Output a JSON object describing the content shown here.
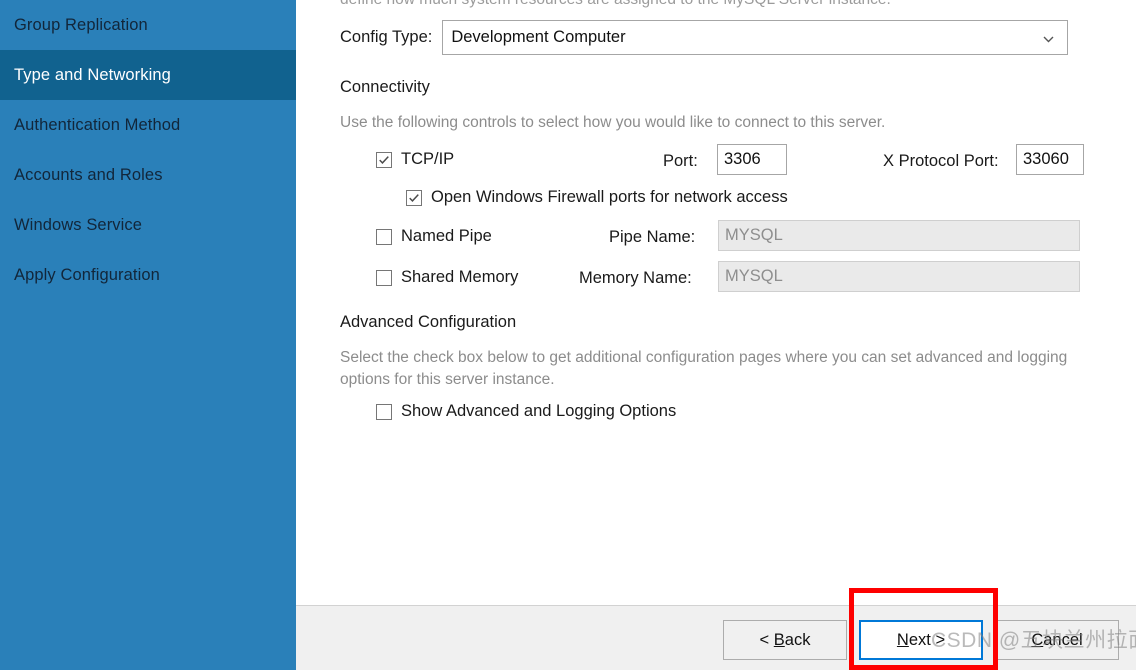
{
  "sidebar": {
    "items": [
      {
        "label": "Group Replication",
        "selected": false
      },
      {
        "label": "Type and Networking",
        "selected": true
      },
      {
        "label": "Authentication Method",
        "selected": false
      },
      {
        "label": "Accounts and Roles",
        "selected": false
      },
      {
        "label": "Windows Service",
        "selected": false
      },
      {
        "label": "Apply Configuration",
        "selected": false
      }
    ]
  },
  "content": {
    "clipped_intro": "define how much system resources are assigned to the MySQL Server instance.",
    "config_type": {
      "label": "Config Type:",
      "value": "Development Computer",
      "icon": "chevron-down-icon"
    },
    "connectivity": {
      "heading": "Connectivity",
      "description": "Use the following controls to select how you would like to connect to this server.",
      "tcpip": {
        "label": "TCP/IP",
        "checked": true
      },
      "port": {
        "label": "Port:",
        "value": "3306"
      },
      "x_protocol_port": {
        "label": "X Protocol Port:",
        "value": "33060"
      },
      "firewall": {
        "label": "Open Windows Firewall ports for network access",
        "checked": true
      },
      "named_pipe": {
        "label": "Named Pipe",
        "checked": false
      },
      "pipe_name": {
        "label": "Pipe Name:",
        "value": "MYSQL",
        "disabled": true
      },
      "shared_memory": {
        "label": "Shared Memory",
        "checked": false
      },
      "memory_name": {
        "label": "Memory Name:",
        "value": "MYSQL",
        "disabled": true
      }
    },
    "advanced": {
      "heading": "Advanced Configuration",
      "description": "Select the check box below to get additional configuration pages where you can set advanced and logging options for this server instance.",
      "show_advanced": {
        "label": "Show Advanced and Logging Options",
        "checked": false
      }
    }
  },
  "footer": {
    "back": {
      "pre": "< ",
      "accel": "B",
      "rest": "ack"
    },
    "next": {
      "accel": "N",
      "rest": "ext >"
    },
    "cancel": {
      "pre": "",
      "accel": "C",
      "rest": "ancel"
    }
  },
  "watermark": {
    "text": "CSDN @五块兰州拉面"
  },
  "colors": {
    "sidebar_bg": "#2a80b9",
    "sidebar_selected_bg": "#11628f",
    "footer_bg": "#f0f0f0",
    "focus_border": "#0078d7",
    "annotation_red": "#fe0000"
  }
}
